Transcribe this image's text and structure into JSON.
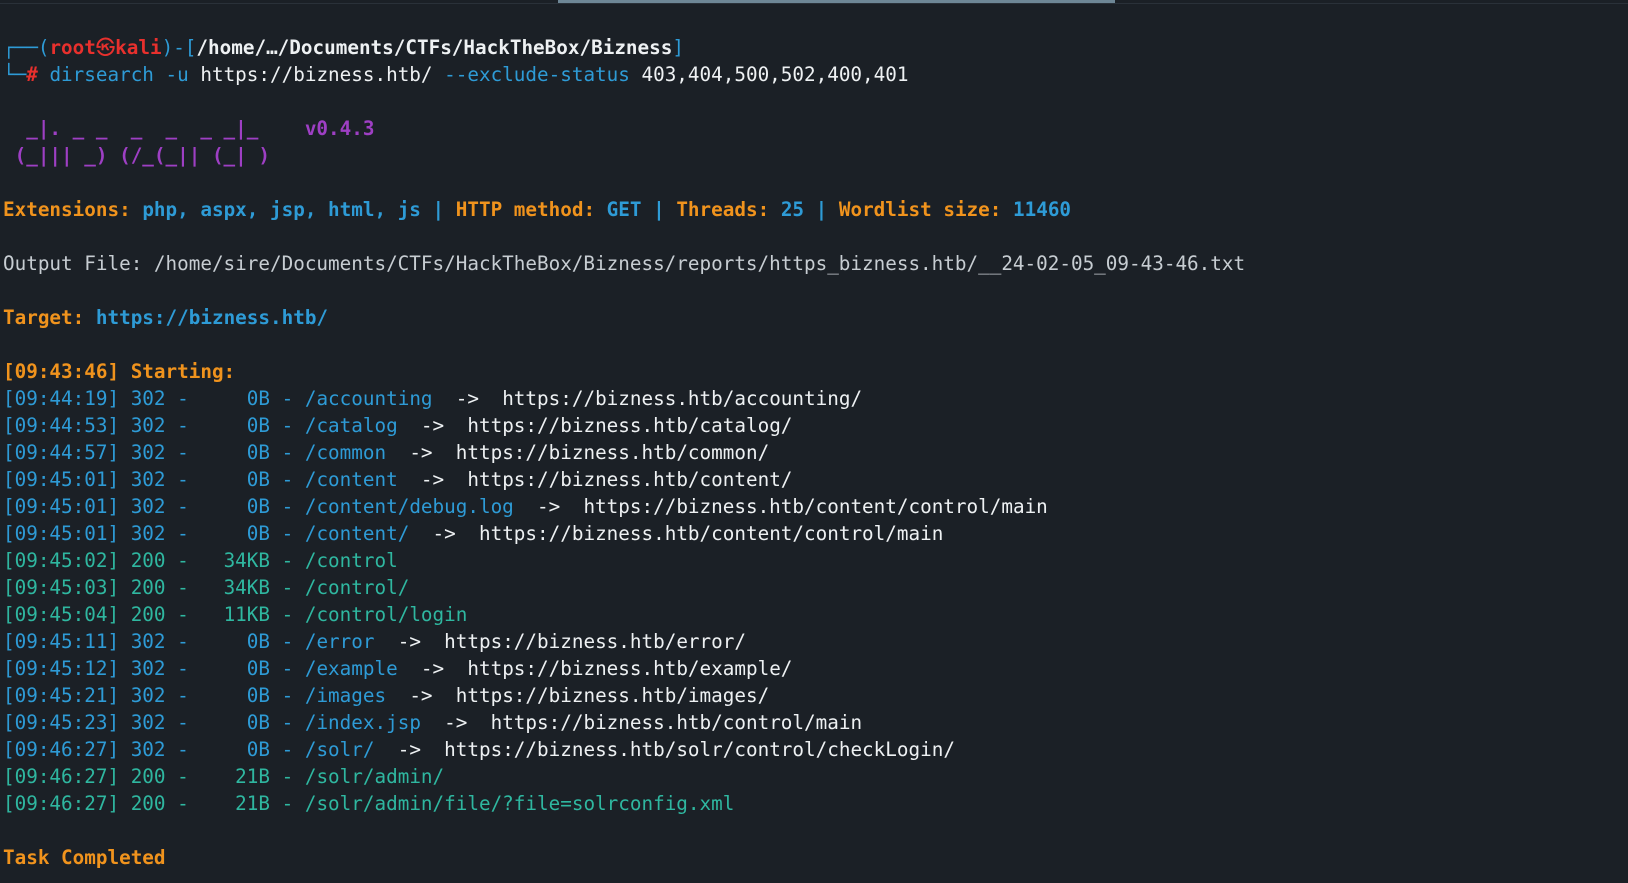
{
  "prompt": {
    "user": "root",
    "skull": "㉿",
    "host": "kali",
    "path": "/home/…/Documents/CTFs/HackTheBox/Bizness",
    "symbol": "#"
  },
  "command": {
    "name": "dirsearch",
    "flag_u": "-u",
    "url": "https://bizness.htb/",
    "flag_exclude": "--exclude-status",
    "status_list": "403,404,500,502,400,401"
  },
  "banner": {
    "line1": "  _|. _ _  _  _  _ _|_    ",
    "version": "v0.4.3",
    "line2": " (_||| _) (/_(_|| (_| )"
  },
  "info": {
    "extensions_label": "Extensions:",
    "extensions_value": "php, aspx, jsp, html, js",
    "method_label": "HTTP method:",
    "method_value": "GET",
    "threads_label": "Threads:",
    "threads_value": "25",
    "wordlist_label": "Wordlist size:",
    "wordlist_value": "11460",
    "separator": "|"
  },
  "output_file": "Output File: /home/sire/Documents/CTFs/HackTheBox/Bizness/reports/https_bizness.htb/__24-02-05_09-43-46.txt",
  "target": {
    "label": "Target:",
    "url": "https://bizness.htb/"
  },
  "start": "[09:43:46] Starting: ",
  "results": [
    {
      "time": "[09:44:19]",
      "code": "302",
      "size": "   0B",
      "path": "/accounting",
      "redirect": "https://bizness.htb/accounting/"
    },
    {
      "time": "[09:44:53]",
      "code": "302",
      "size": "   0B",
      "path": "/catalog",
      "redirect": "https://bizness.htb/catalog/"
    },
    {
      "time": "[09:44:57]",
      "code": "302",
      "size": "   0B",
      "path": "/common",
      "redirect": "https://bizness.htb/common/"
    },
    {
      "time": "[09:45:01]",
      "code": "302",
      "size": "   0B",
      "path": "/content",
      "redirect": "https://bizness.htb/content/"
    },
    {
      "time": "[09:45:01]",
      "code": "302",
      "size": "   0B",
      "path": "/content/debug.log",
      "redirect": "https://bizness.htb/content/control/main"
    },
    {
      "time": "[09:45:01]",
      "code": "302",
      "size": "   0B",
      "path": "/content/",
      "redirect": "https://bizness.htb/content/control/main"
    },
    {
      "time": "[09:45:02]",
      "code": "200",
      "size": "  34KB",
      "path": "/control",
      "redirect": ""
    },
    {
      "time": "[09:45:03]",
      "code": "200",
      "size": "  34KB",
      "path": "/control/",
      "redirect": ""
    },
    {
      "time": "[09:45:04]",
      "code": "200",
      "size": "  11KB",
      "path": "/control/login",
      "redirect": ""
    },
    {
      "time": "[09:45:11]",
      "code": "302",
      "size": "   0B",
      "path": "/error",
      "redirect": "https://bizness.htb/error/"
    },
    {
      "time": "[09:45:12]",
      "code": "302",
      "size": "   0B",
      "path": "/example",
      "redirect": "https://bizness.htb/example/"
    },
    {
      "time": "[09:45:21]",
      "code": "302",
      "size": "   0B",
      "path": "/images",
      "redirect": "https://bizness.htb/images/"
    },
    {
      "time": "[09:45:23]",
      "code": "302",
      "size": "   0B",
      "path": "/index.jsp",
      "redirect": "https://bizness.htb/control/main"
    },
    {
      "time": "[09:46:27]",
      "code": "302",
      "size": "   0B",
      "path": "/solr/",
      "redirect": "https://bizness.htb/solr/control/checkLogin/"
    },
    {
      "time": "[09:46:27]",
      "code": "200",
      "size": "  21B",
      "path": "/solr/admin/",
      "redirect": ""
    },
    {
      "time": "[09:46:27]",
      "code": "200",
      "size": "  21B",
      "path": "/solr/admin/file/?file=solrconfig.xml",
      "redirect": ""
    }
  ],
  "done": "Task Completed",
  "colors": {
    "background": "#1b2026",
    "blue": "#2e9bd6",
    "green": "#2fb7a0",
    "orange": "#f0931d",
    "red": "#e8302d",
    "purple": "#9e3fc4"
  }
}
